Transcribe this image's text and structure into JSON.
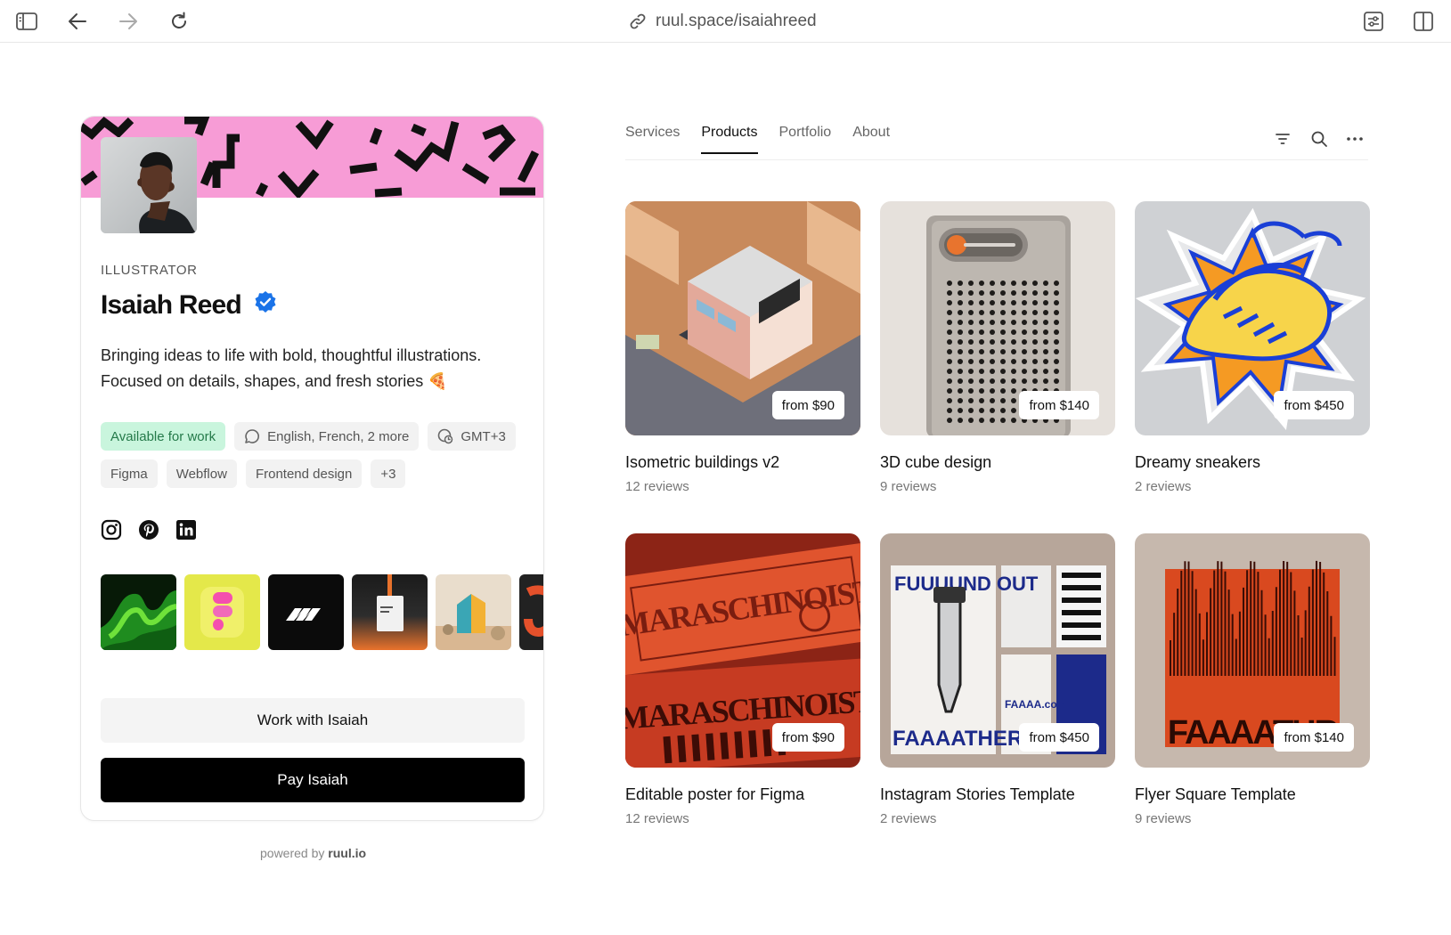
{
  "browser": {
    "url": "ruul.space/isaiahreed",
    "icons": [
      "sidebar-toggle-icon",
      "back-arrow-icon",
      "forward-arrow-icon",
      "reload-icon",
      "link-icon",
      "customize-icon",
      "split-view-icon"
    ]
  },
  "profile": {
    "role": "ILLUSTRATOR",
    "name": "Isaiah Reed",
    "bio_line1": "Bringing ideas to life with bold, thoughtful illustrations.",
    "bio_line2": "Focused on details, shapes, and fresh stories",
    "bio_emoji": "🍕",
    "availability": "Available for work",
    "languages": "English, French, 2 more",
    "timezone": "GMT+3",
    "skills": [
      "Figma",
      "Webflow",
      "Frontend design",
      "+3"
    ],
    "socials": [
      "instagram-icon",
      "pinterest-icon",
      "linkedin-icon"
    ],
    "work_button": "Work with Isaiah",
    "pay_button": "Pay Isaiah"
  },
  "footer": {
    "powered_prefix": "powered by ",
    "powered_brand": "ruul.io"
  },
  "nav": {
    "tabs": [
      "Services",
      "Products",
      "Portfolio",
      "About"
    ],
    "active_tab": "Products",
    "tools": [
      "filter-icon",
      "search-icon",
      "more-icon"
    ]
  },
  "products": [
    {
      "title": "Isometric buildings v2",
      "reviews": "12 reviews",
      "price": "from $90"
    },
    {
      "title": "3D cube design",
      "reviews": "9 reviews",
      "price": "from $140"
    },
    {
      "title": "Dreamy sneakers",
      "reviews": "2 reviews",
      "price": "from $450"
    },
    {
      "title": "Editable poster for Figma",
      "reviews": "12 reviews",
      "price": "from $90"
    },
    {
      "title": "Instagram Stories Template",
      "reviews": "2 reviews",
      "price": "from $450"
    },
    {
      "title": "Flyer Square Template",
      "reviews": "9 reviews",
      "price": "from $140"
    }
  ],
  "colors": {
    "banner": "#f79cd6",
    "available_bg": "#c9f5dd",
    "available_text": "#257a4a",
    "verified": "#1a73e8",
    "primary_button": "#000000"
  }
}
